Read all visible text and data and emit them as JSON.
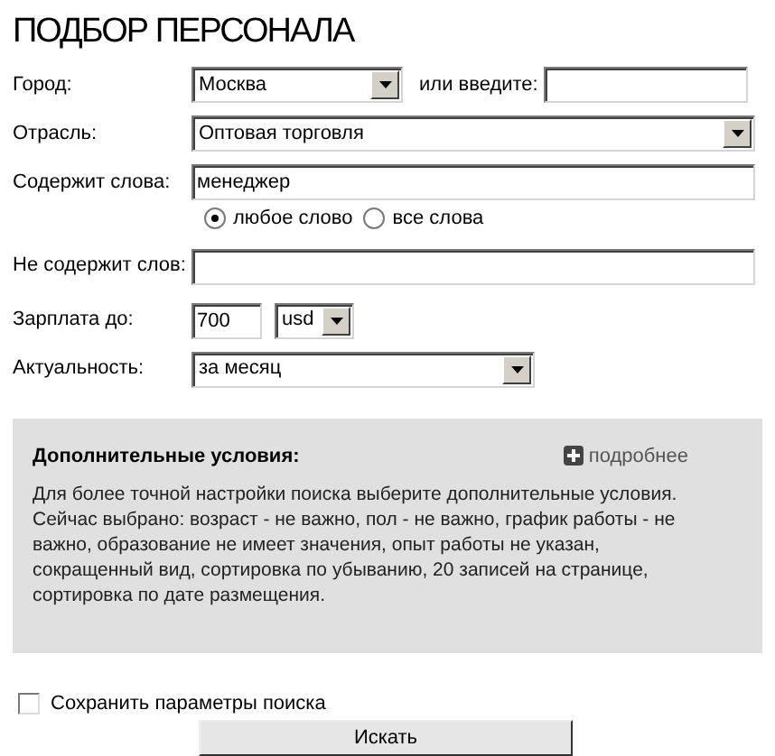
{
  "title": "ПОДБОР ПЕРСОНАЛА",
  "city": {
    "label": "Город:",
    "value": "Москва",
    "or_label": "или введите:"
  },
  "industry": {
    "label": "Отрасль:",
    "value": "Оптовая торговля"
  },
  "contains": {
    "label": "Содержит слова:",
    "value": "менеджер"
  },
  "match_mode": [
    {
      "label": "любое слово",
      "selected": true
    },
    {
      "label": "все слова",
      "selected": false
    }
  ],
  "excludes": {
    "label": "Не содержит слов:"
  },
  "salary": {
    "label": "Зарплата до:",
    "value": "700",
    "currency": "usd"
  },
  "freshness": {
    "label": "Актуальность:",
    "value": "за месяц"
  },
  "extra": {
    "title": "Дополнительные условия:",
    "more_link": "подробнее",
    "paragraphs": [
      "Для более точной настройки поиска выберите дополнительные условия.",
      "Сейчас выбрано: возраст - не важно, пол - не важно, график работы - не важно, образование не имеет значения, опыт работы не указан, сокращенный вид, сортировка по убыванию, 20 записей на странице, сортировка по дате размещения."
    ]
  },
  "save_params": {
    "label": "Сохранить параметры поиска",
    "checked": false
  },
  "search_button": "Искать"
}
